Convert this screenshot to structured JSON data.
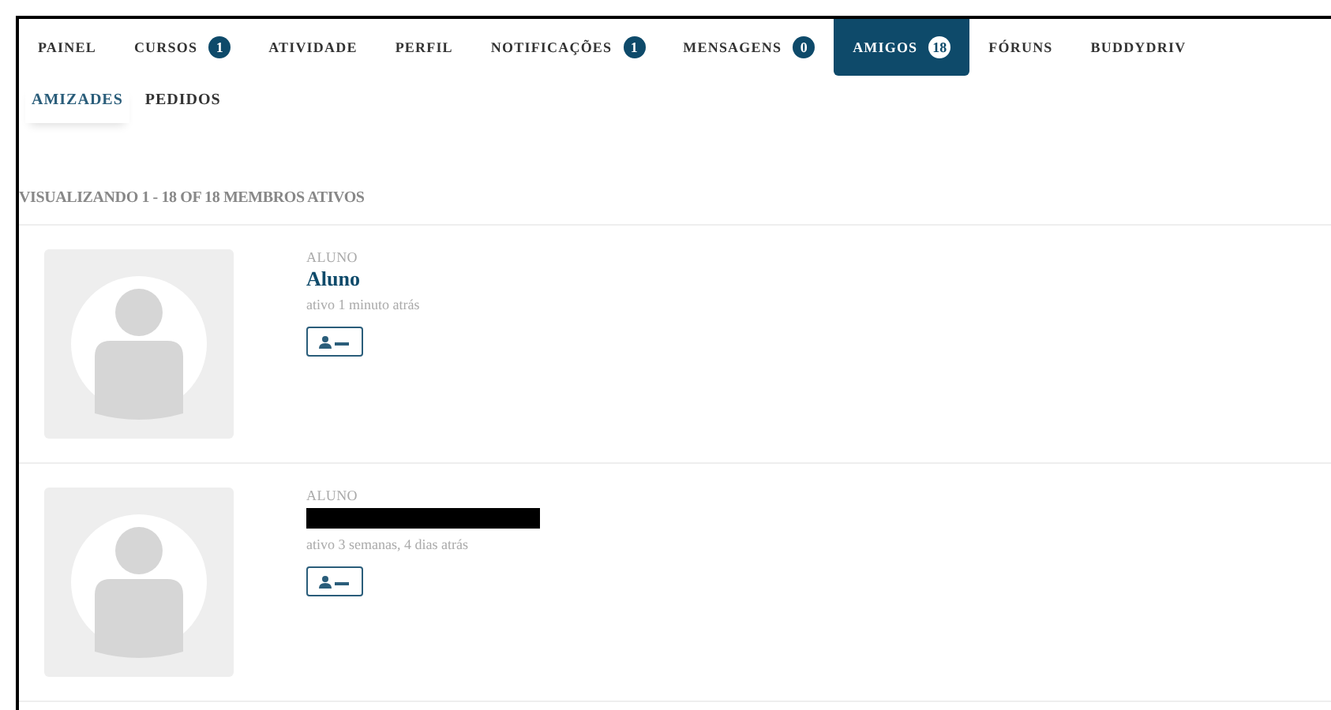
{
  "nav": [
    {
      "label": "PAINEL",
      "selected": false
    },
    {
      "label": "CURSOS",
      "count": "1",
      "selected": false
    },
    {
      "label": "ATIVIDADE",
      "selected": false
    },
    {
      "label": "PERFIL",
      "selected": false
    },
    {
      "label": "NOTIFICAÇÕES",
      "count": "1",
      "selected": false
    },
    {
      "label": "MENSAGENS",
      "count": "0",
      "selected": false
    },
    {
      "label": "AMIGOS",
      "count": "18",
      "selected": true
    },
    {
      "label": "FÓRUNS",
      "selected": false
    },
    {
      "label": "BUDDYDRIV",
      "selected": false
    }
  ],
  "subnav": [
    {
      "label": "AMIZADES",
      "selected": true
    },
    {
      "label": "PEDIDOS",
      "selected": false
    }
  ],
  "summary": "VISUALIZANDO 1 - 18 OF 18 MEMBROS ATIVOS",
  "members": [
    {
      "role": "ALUNO",
      "name": "Aluno",
      "redacted": false,
      "last_active": "ativo 1 minuto atrás"
    },
    {
      "role": "ALUNO",
      "redacted": true,
      "last_active": "ativo 3 semanas, 4 dias atrás"
    }
  ]
}
